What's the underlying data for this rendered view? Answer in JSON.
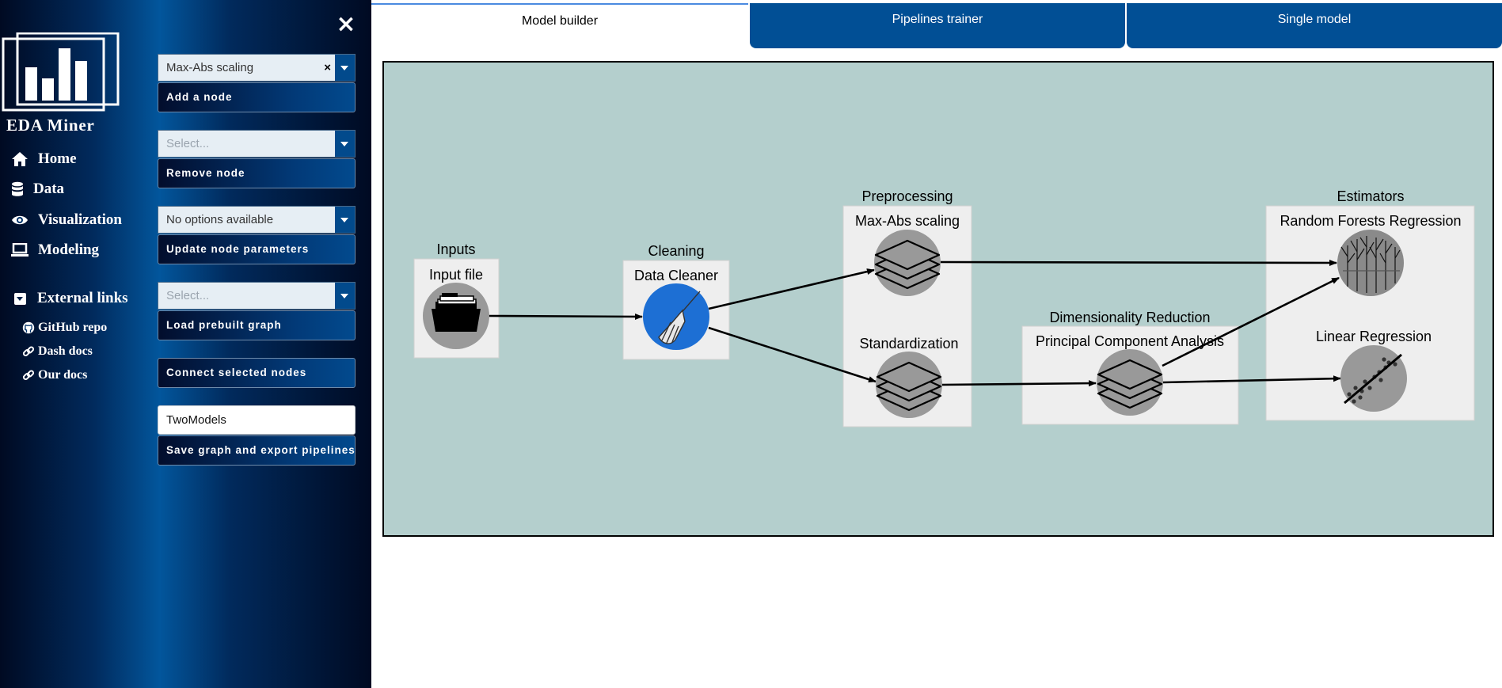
{
  "app": {
    "title": "EDA Miner"
  },
  "sidebar": {
    "close_label": "×",
    "nav": [
      {
        "label": "Home",
        "icon": "home-icon"
      },
      {
        "label": "Data",
        "icon": "database-icon"
      },
      {
        "label": "Visualization",
        "icon": "eye-icon"
      },
      {
        "label": "Modeling",
        "icon": "laptop-icon"
      }
    ],
    "external_header": "External links",
    "external_links": [
      {
        "label": "GitHub repo",
        "icon": "github-icon"
      },
      {
        "label": "Dash docs",
        "icon": "link-icon"
      },
      {
        "label": "Our docs",
        "icon": "link-icon"
      }
    ],
    "controls": {
      "node_type_dropdown": {
        "value": "Max-Abs scaling",
        "clear": "×"
      },
      "add_node_label": "Add a node",
      "remove_dropdown": {
        "placeholder": "Select..."
      },
      "remove_node_label": "Remove node",
      "params_dropdown": {
        "value": "No options available"
      },
      "update_params_label": "Update node parameters",
      "prebuilt_dropdown": {
        "placeholder": "Select..."
      },
      "load_prebuilt_label": "Load prebuilt graph",
      "connect_label": "Connect selected nodes",
      "graph_name_value": "TwoModels",
      "save_label": "Save graph and export pipelines"
    }
  },
  "tabs": [
    {
      "label": "Model builder",
      "active": true
    },
    {
      "label": "Pipelines trainer",
      "active": false
    },
    {
      "label": "Single model",
      "active": false
    }
  ],
  "graph": {
    "groups": {
      "inputs": "Inputs",
      "cleaning": "Cleaning",
      "preprocessing": "Preprocessing",
      "dim_reduction": "Dimensionality Reduction",
      "estimators": "Estimators"
    },
    "nodes": {
      "input_file": {
        "label": "Input file",
        "icon": "folder-icon"
      },
      "data_cleaner": {
        "label": "Data Cleaner",
        "icon": "broom-icon"
      },
      "max_abs": {
        "label": "Max-Abs scaling",
        "icon": "layers-icon"
      },
      "standardization": {
        "label": "Standardization",
        "icon": "layers-icon"
      },
      "pca": {
        "label": "Principal Component Analysis",
        "icon": "layers-icon"
      },
      "random_forest": {
        "label": "Random Forests Regression",
        "icon": "forest-icon"
      },
      "linear_regression": {
        "label": "Linear Regression",
        "icon": "scatter-line-icon"
      }
    },
    "edges": [
      [
        "Input file",
        "Data Cleaner"
      ],
      [
        "Data Cleaner",
        "Max-Abs scaling"
      ],
      [
        "Data Cleaner",
        "Standardization"
      ],
      [
        "Max-Abs scaling",
        "Random Forests Regression"
      ],
      [
        "Standardization",
        "Principal Component Analysis"
      ],
      [
        "Principal Component Analysis",
        "Random Forests Regression"
      ],
      [
        "Principal Component Analysis",
        "Linear Regression"
      ]
    ]
  },
  "colors": {
    "canvas_bg": "#b4cfcd",
    "tab_active_bg": "#ffffff",
    "tab_inactive_bg": "#014f95",
    "node_box_bg": "#eeeeee",
    "node_circle": "#999999",
    "cleaner_circle": "#1d6fd4"
  }
}
